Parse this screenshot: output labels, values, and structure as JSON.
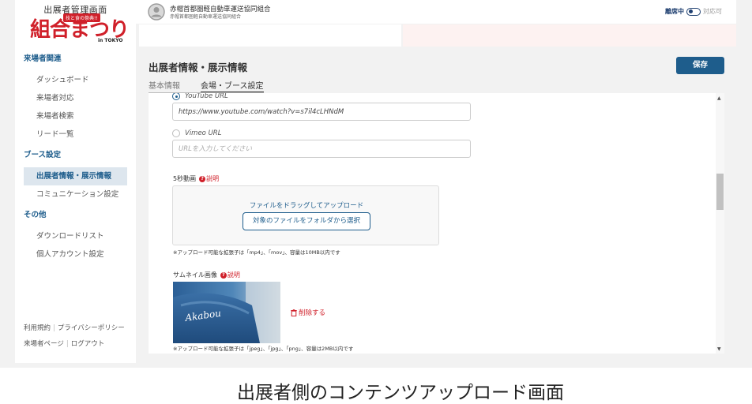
{
  "sidebar": {
    "logo_title": "出展者管理画面",
    "logo_text": "組合まつり",
    "logo_badge": "技と食の祭典!!",
    "logo_sub": "in TOKYO",
    "sections": [
      {
        "title": "来場者関連",
        "items": [
          "ダッシュボード",
          "来場者対応",
          "来場者検索",
          "リード一覧"
        ]
      },
      {
        "title": "ブース設定",
        "items": [
          "出展者情報・展示情報",
          "コミュニケーション設定"
        ]
      },
      {
        "title": "その他",
        "items": [
          "ダウンロードリスト",
          "個人アカウント設定"
        ]
      }
    ],
    "footer": {
      "terms": "利用規約",
      "privacy": "プライバシーポリシー",
      "visitor_page": "来場者ページ",
      "logout": "ログアウト"
    }
  },
  "header": {
    "org_name": "赤帽首都圏軽自動車運送協同組合",
    "org_sub": "赤帽首都圏軽自動車運送協同組合",
    "status_on": "離席中",
    "status_off": "対応可"
  },
  "page": {
    "title": "出展者情報・展示情報",
    "save_label": "保存",
    "tabs": [
      "基本情報",
      "会場・ブース設定"
    ]
  },
  "form": {
    "youtube_label": "YouTube URL",
    "youtube_value": "https://www.youtube.com/watch?v=s7il4cLHNdM",
    "vimeo_label": "Vimeo URL",
    "vimeo_placeholder": "URLを入力してください",
    "video_label": "5秒動画",
    "help_text": "説明",
    "drop_text": "ファイルをドラッグしてアップロード",
    "select_button": "対象のファイルをフォルダから選択",
    "video_note": "※アップロード可能な拡張子は「mp4」、「mov」、容量は10MB以内です",
    "thumb_label": "サムネイル画像",
    "thumb_brand": "Akabou",
    "delete_label": "削除する",
    "thumb_note": "※アップロード可能な拡張子は「jpeg」、「jpg」、「png」、容量は2MB以内です"
  },
  "caption": "出展者側のコンテンツアップロード画面",
  "colors": {
    "accent": "#1e5d8c",
    "brand_red": "#d0202a",
    "active_nav_bg": "#dde6ee"
  }
}
